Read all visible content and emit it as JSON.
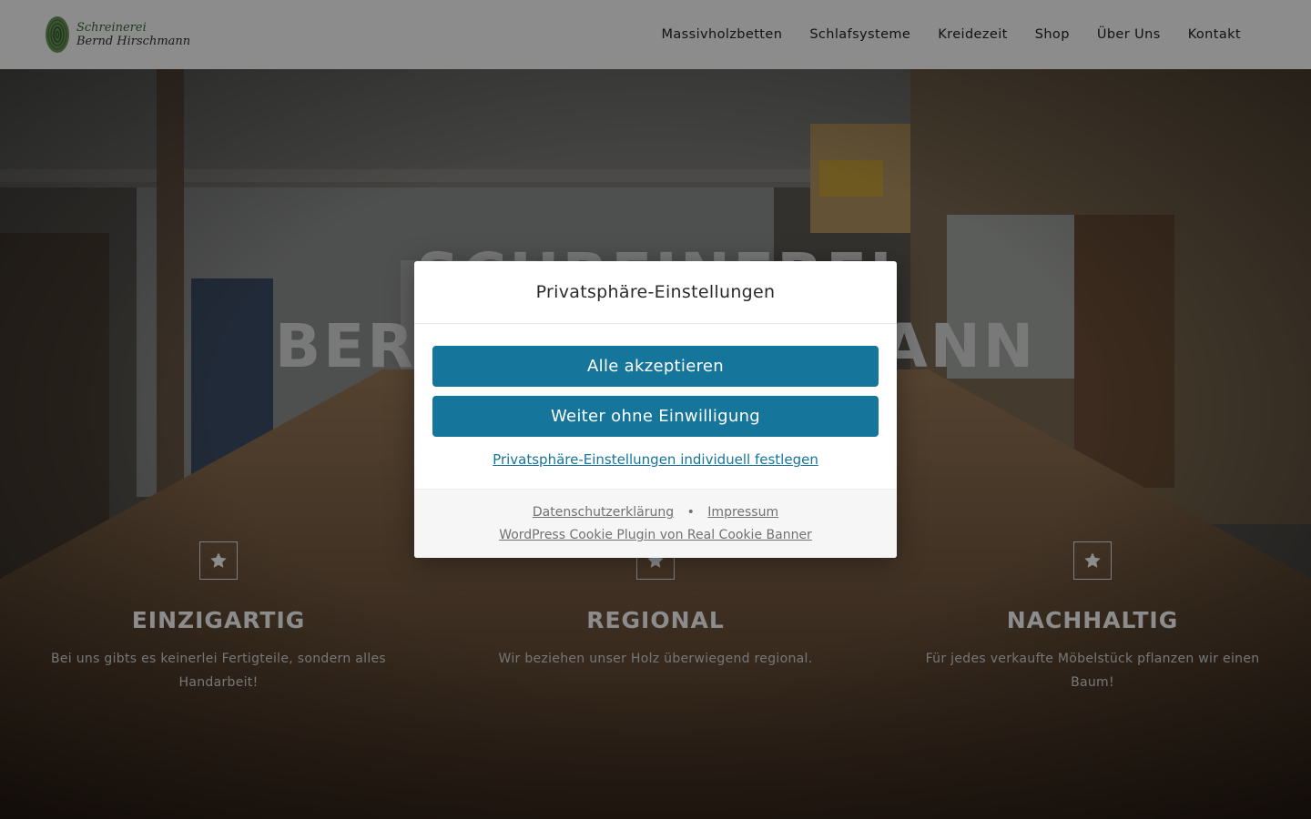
{
  "header": {
    "logo": {
      "line1": "Schreinerei",
      "line2": "Bernd Hirschmann"
    },
    "nav": [
      "Massivholzbetten",
      "Schlafsysteme",
      "Kreidezeit",
      "Shop",
      "Über Uns",
      "Kontakt"
    ]
  },
  "hero": {
    "title_line1": "SCHREINEREI",
    "title_line2": "BERND HIRSCHMANN",
    "features": [
      {
        "icon": "star-icon",
        "title": "EINZIGARTIG",
        "text": "Bei uns gibts es keinerlei Fertigteile, sondern alles Handarbeit!"
      },
      {
        "icon": "star-icon",
        "title": "REGIONAL",
        "text": "Wir beziehen unser Holz überwiegend regional."
      },
      {
        "icon": "star-icon",
        "title": "NACHHALTIG",
        "text": "Für jedes verkaufte Möbelstück pflanzen wir einen Baum!"
      }
    ]
  },
  "consent": {
    "title": "Privatsphäre-Einstellungen",
    "accept_all": "Alle akzeptieren",
    "continue_without": "Weiter ohne Einwilligung",
    "customize": "Privatsphäre-Einstellungen individuell festlegen",
    "privacy_policy": "Datenschutzerklärung",
    "separator": "•",
    "imprint": "Impressum",
    "plugin_credit": "WordPress Cookie Plugin von Real Cookie Banner"
  },
  "colors": {
    "primary_button": "#15759b",
    "overlay": "rgba(0,0,0,0.45)"
  }
}
